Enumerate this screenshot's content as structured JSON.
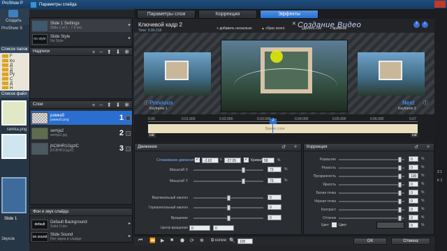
{
  "background_app": {
    "title": "ProShow P",
    "create_label": "Создать",
    "app_label": "ProShow S",
    "folders_header": "Список папок",
    "files_header": "Список файл",
    "folder_items": [
      "F",
      "Ко",
      "Д",
      "Д",
      "Ру",
      "С",
      "Д",
      "Н"
    ],
    "file_label": "ramka.png",
    "slide_label": "Slide 1",
    "sound_label": "Звуков"
  },
  "dialog": {
    "title": "Параметры слайда",
    "ok_label": "OK",
    "cancel_label": "Отмена",
    "colors": {
      "accent": "#2a6fd0",
      "tab_active": "#3c7dd6"
    }
  },
  "left_panel": {
    "slide_options": [
      {
        "title": "Slide 1 Settings",
        "sub": "Slide 1 of 1 - 7.5 sec",
        "thumb": ""
      },
      {
        "title": "Slide Style",
        "sub": "No Style",
        "thumb": "no style"
      }
    ],
    "captions_header": "Надписи",
    "layers_header": "Слои",
    "layers": [
      {
        "name": "рамка5",
        "sub": "рамка5.png",
        "num": "1",
        "selected": true
      },
      {
        "name": "semja2",
        "sub": "semja2.jpg",
        "num": "2",
        "selected": false
      },
      {
        "name": "jhC8HR1GgzlC",
        "sub": "jhC8HR1GgzlC",
        "num": "3",
        "selected": false
      }
    ],
    "bg_sound_header": "Фон и звук слайда",
    "bg_items": [
      {
        "thumb": "default",
        "title": "Default Background",
        "sub": "Solid Color"
      },
      {
        "thumb": "no sound",
        "title": "Slide Sound",
        "sub": "Нет звука в слайде"
      }
    ]
  },
  "tabs": [
    "Параметры слоя",
    "Коррекция",
    "Эффекты"
  ],
  "active_tab_index": 2,
  "keyframe": {
    "title": "Ключевой кадр 2",
    "time": "Time: 0.00.218",
    "add_label": "добавить несколько",
    "reset_label": "сброс всего",
    "delete_label": "удалить сое",
    "time_label": "времени",
    "watermark": "Создание Видео"
  },
  "preview": {
    "previous_label": "Previous",
    "previous_sub": "Keyframe 1",
    "next_label": "Next",
    "next_sub": "Keyframe 3"
  },
  "timeline": {
    "ticks": [
      "0.00",
      "0.01.000",
      "0.02.000",
      "0.03.000",
      "0.04.000",
      "0.05.000",
      "0.06.000",
      "0.07"
    ],
    "marker_label": "2",
    "cut_label": "cut",
    "caption": "Время слоя"
  },
  "motion": {
    "header": "Движение",
    "smooth_label": "Сглаживание движения",
    "x_value": "-2.62",
    "y_value": "-27.05",
    "curve_label": "Кривая",
    "curve_value": "58",
    "pct": "%",
    "rows": [
      {
        "label": "Масштаб X",
        "value": "73",
        "unit": "%",
        "level": 0.73
      },
      {
        "label": "Масштаб Y",
        "value": "73",
        "unit": "%",
        "level": 0.73
      },
      {
        "label": "Вертикальный наклон",
        "value": "0",
        "unit": "",
        "level": 0.5
      },
      {
        "label": "Горизонтальный наклон",
        "value": "0",
        "unit": "",
        "level": 0.5
      },
      {
        "label": "Вращение",
        "value": "0",
        "unit": "",
        "level": 0.5
      }
    ],
    "rotation_center_label": "Центр вращения",
    "rc_x": "0",
    "rc_y": "0"
  },
  "correction": {
    "header": "Коррекция",
    "rows": [
      {
        "label": "Размытие",
        "value": "0",
        "level": 0.95
      },
      {
        "label": "Резкость",
        "value": "0",
        "level": 0.95
      },
      {
        "label": "Прозрачность",
        "value": "100",
        "level": 0.95
      },
      {
        "label": "Яркость",
        "value": "0",
        "level": 0.95
      },
      {
        "label": "Белая точка",
        "value": "0",
        "level": 0.95
      },
      {
        "label": "Чёрная точка",
        "value": "0",
        "level": 0.95
      },
      {
        "label": "Контраст",
        "value": "0",
        "level": 0.95
      },
      {
        "label": "Оттенок",
        "value": "0",
        "level": 0.95
      }
    ],
    "color_label": "Цвет",
    "color_check_label": "Цвет",
    "color_value": "0",
    "pct": "%"
  },
  "bottom_toolbar": {
    "copy_label": "копии",
    "zoom_value": "100"
  },
  "right_edge": {
    "labels": [
      "3 1",
      "Ir 1"
    ]
  }
}
